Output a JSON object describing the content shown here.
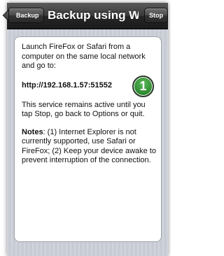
{
  "navbar": {
    "back_label": "Backup",
    "title": "Backup using Wi...",
    "stop_label": "Stop"
  },
  "content": {
    "intro": "Launch FireFox or Safari from a computer on the same local network and go to:",
    "url": "http://192.168.1.57:51552",
    "step_badge": "1",
    "service_note": "This service remains active until you tap Stop, go back to Options or quit.",
    "notes_label": "Notes",
    "notes_text": ": (1) Internet Explorer is not currently supported, use Safari or FireFox; (2) Keep your device awake to prevent interruption of the connection."
  },
  "colors": {
    "navbar": "#262626",
    "badge": "#2e8b2e",
    "background": "#c7cbd3"
  }
}
